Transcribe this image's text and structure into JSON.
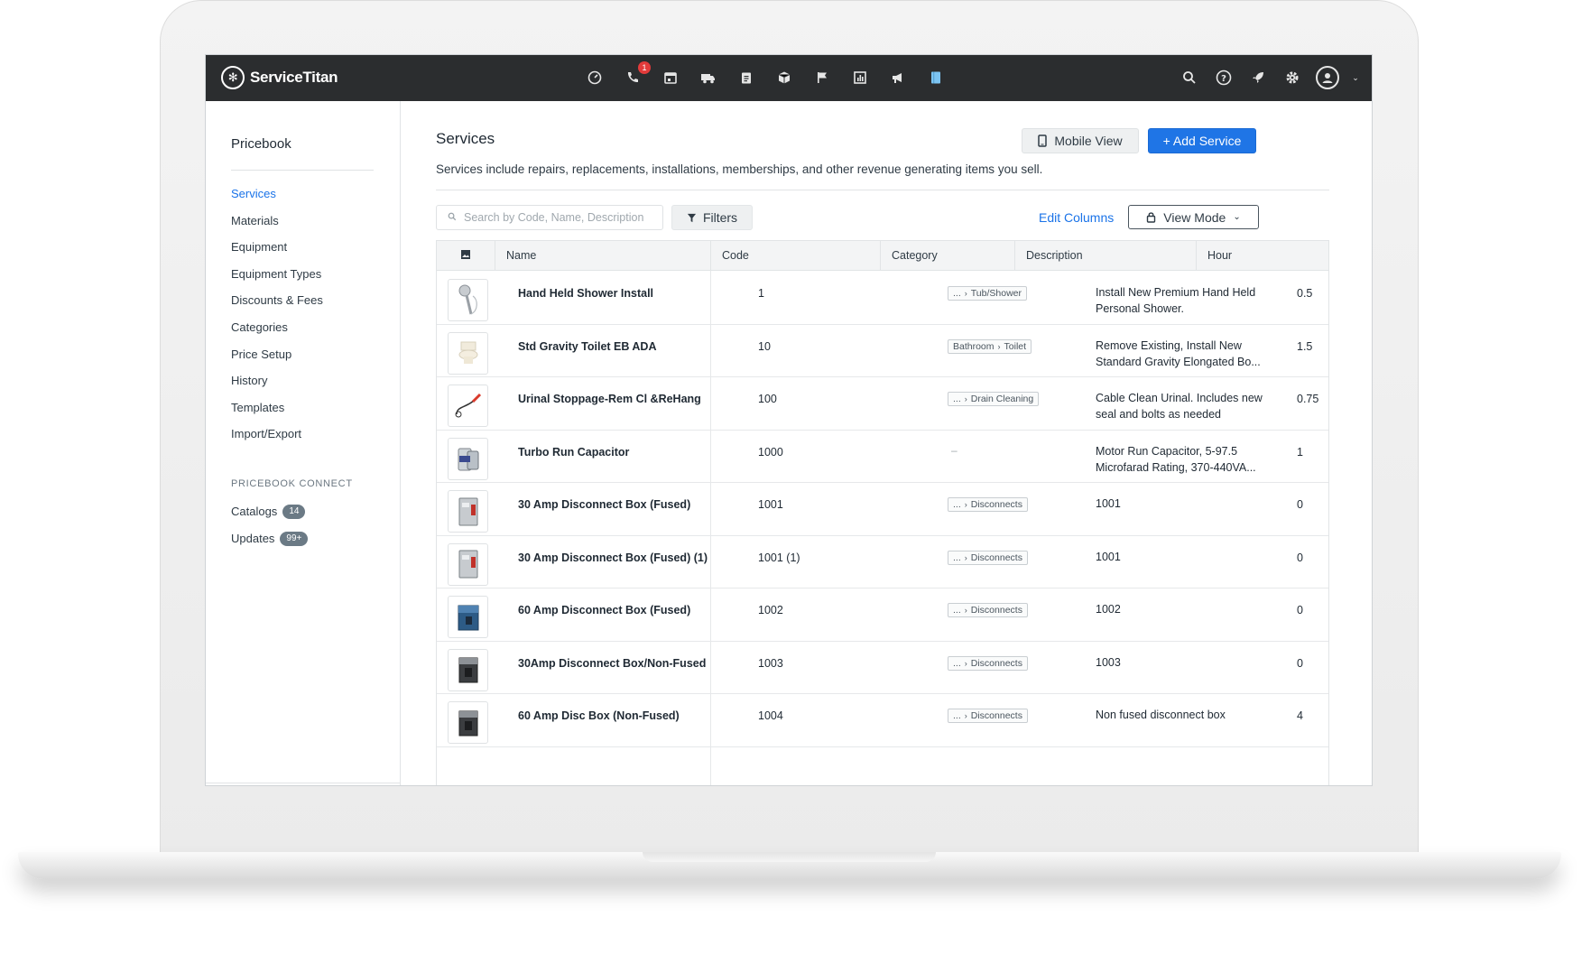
{
  "app": {
    "brand": "ServiceTitan",
    "nav_icons": [
      "dashboard-icon",
      "phone-icon",
      "calendar-icon",
      "dispatch-truck-icon",
      "clipboard-icon",
      "inventory-box-icon",
      "flag-icon",
      "reports-chart-icon",
      "marketing-megaphone-icon",
      "pricebook-book-icon"
    ],
    "phone_badge": "1",
    "right_icons": [
      "search-icon",
      "help-icon",
      "rocket-icon",
      "settings-gear-icon",
      "user-avatar-icon"
    ]
  },
  "sidebar": {
    "title": "Pricebook",
    "items": [
      {
        "label": "Services",
        "active": true
      },
      {
        "label": "Materials"
      },
      {
        "label": "Equipment"
      },
      {
        "label": "Equipment Types"
      },
      {
        "label": "Discounts & Fees"
      },
      {
        "label": "Categories"
      },
      {
        "label": "Price Setup"
      },
      {
        "label": "History"
      },
      {
        "label": "Templates"
      },
      {
        "label": "Import/Export"
      }
    ],
    "connect_section": "PRICEBOOK CONNECT",
    "connect_items": [
      {
        "label": "Catalogs",
        "count": "14"
      },
      {
        "label": "Updates",
        "count": "99+"
      }
    ]
  },
  "main": {
    "title": "Services",
    "description": "Services include repairs, replacements, installations, memberships, and other revenue generating items you sell.",
    "mobile_view_label": "Mobile View",
    "add_service_label": "+ Add Service",
    "search_placeholder": "Search by Code, Name, Description",
    "filters_label": "Filters",
    "edit_columns_label": "Edit Columns",
    "view_mode_label": "View Mode"
  },
  "table": {
    "columns": [
      "Name",
      "Code",
      "Category",
      "Description",
      "Hour"
    ],
    "rows": [
      {
        "name": "Hand Held Shower Install",
        "code": "1",
        "category": [
          "...",
          "Tub/Shower"
        ],
        "description": "Install New Premium Hand Held Personal Shower.",
        "hours": "0.5",
        "thumb": "shower-head-image"
      },
      {
        "name": "Std Gravity Toilet EB ADA",
        "code": "10",
        "category": [
          "Bathroom",
          "Toilet"
        ],
        "description": "Remove Existing, Install New Standard Gravity Elongated Bo...",
        "hours": "1.5",
        "thumb": "toilet-image"
      },
      {
        "name": "Urinal Stoppage-Rem Cl &ReHang",
        "code": "100",
        "category": [
          "...",
          "Drain Cleaning"
        ],
        "description": "Cable Clean Urinal. Includes new seal and bolts as needed",
        "hours": "0.75",
        "thumb": "drain-cable-image"
      },
      {
        "name": "Turbo Run Capacitor",
        "code": "1000",
        "category": [],
        "description": "Motor Run Capacitor, 5-97.5 Microfarad Rating, 370-440VA...",
        "hours": "1",
        "thumb": "capacitor-image"
      },
      {
        "name": "30 Amp Disconnect Box (Fused)",
        "code": "1001",
        "category": [
          "...",
          "Disconnects"
        ],
        "description": "1001",
        "hours": "0",
        "thumb": "disconnect-box-image"
      },
      {
        "name": "30 Amp Disconnect Box (Fused) (1)",
        "code": "1001 (1)",
        "category": [
          "...",
          "Disconnects"
        ],
        "description": "1001",
        "hours": "0",
        "thumb": "disconnect-box-image"
      },
      {
        "name": "60 Amp Disconnect Box (Fused)",
        "code": "1002",
        "category": [
          "...",
          "Disconnects"
        ],
        "description": "1002",
        "hours": "0",
        "thumb": "disconnect-box-blue-image"
      },
      {
        "name": "30Amp Disconnect Box/Non-Fused",
        "code": "1003",
        "category": [
          "...",
          "Disconnects"
        ],
        "description": "1003",
        "hours": "0",
        "thumb": "disconnect-box-dark-image"
      },
      {
        "name": "60 Amp Disc Box (Non-Fused)",
        "code": "1004",
        "category": [
          "...",
          "Disconnects"
        ],
        "description": "Non fused disconnect box",
        "hours": "4",
        "thumb": "disconnect-box-dark-image"
      }
    ]
  },
  "colors": {
    "topbar": "#2b2d2f",
    "accent": "#1f75e6",
    "link": "#1a73e8"
  }
}
